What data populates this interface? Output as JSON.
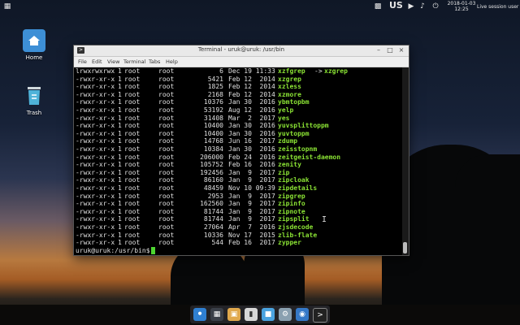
{
  "topbar": {
    "lang": "US",
    "clock_date": "2018-01-03",
    "clock_time": "12:25",
    "user": "Live session user"
  },
  "desktop": {
    "icons": [
      {
        "label": "Home",
        "icon": "home-folder-icon"
      },
      {
        "label": "Trash",
        "icon": "trash-icon"
      }
    ]
  },
  "terminal": {
    "title": "Terminal - uruk@uruk: /usr/bin",
    "menu": [
      "File",
      "Edit",
      "View",
      "Terminal",
      "Tabs",
      "Help"
    ],
    "rows": [
      {
        "perm": "lrwxrwxrwx",
        "links": "1",
        "owner": "root",
        "group": "root",
        "size": "6",
        "date": "Dec 19 11:33",
        "name": "xzfgrep",
        "target": "xzgrep"
      },
      {
        "perm": "-rwxr-xr-x",
        "links": "1",
        "owner": "root",
        "group": "root",
        "size": "5421",
        "date": "Feb 12  2014",
        "name": "xzgrep",
        "target": ""
      },
      {
        "perm": "-rwxr-xr-x",
        "links": "1",
        "owner": "root",
        "group": "root",
        "size": "1825",
        "date": "Feb 12  2014",
        "name": "xzless",
        "target": ""
      },
      {
        "perm": "-rwxr-xr-x",
        "links": "1",
        "owner": "root",
        "group": "root",
        "size": "2168",
        "date": "Feb 12  2014",
        "name": "xzmore",
        "target": ""
      },
      {
        "perm": "-rwxr-xr-x",
        "links": "1",
        "owner": "root",
        "group": "root",
        "size": "10376",
        "date": "Jan 30  2016",
        "name": "ybmtopbm",
        "target": ""
      },
      {
        "perm": "-rwxr-xr-x",
        "links": "1",
        "owner": "root",
        "group": "root",
        "size": "53192",
        "date": "Aug 12  2016",
        "name": "yelp",
        "target": ""
      },
      {
        "perm": "-rwxr-xr-x",
        "links": "1",
        "owner": "root",
        "group": "root",
        "size": "31408",
        "date": "Mar  2  2017",
        "name": "yes",
        "target": ""
      },
      {
        "perm": "-rwxr-xr-x",
        "links": "1",
        "owner": "root",
        "group": "root",
        "size": "10400",
        "date": "Jan 30  2016",
        "name": "yuvsplittoppm",
        "target": ""
      },
      {
        "perm": "-rwxr-xr-x",
        "links": "1",
        "owner": "root",
        "group": "root",
        "size": "10400",
        "date": "Jan 30  2016",
        "name": "yuvtoppm",
        "target": ""
      },
      {
        "perm": "-rwxr-xr-x",
        "links": "1",
        "owner": "root",
        "group": "root",
        "size": "14768",
        "date": "Jun 16  2017",
        "name": "zdump",
        "target": ""
      },
      {
        "perm": "-rwxr-xr-x",
        "links": "1",
        "owner": "root",
        "group": "root",
        "size": "10384",
        "date": "Jan 30  2016",
        "name": "zeisstopnm",
        "target": ""
      },
      {
        "perm": "-rwxr-xr-x",
        "links": "1",
        "owner": "root",
        "group": "root",
        "size": "206000",
        "date": "Feb 24  2016",
        "name": "zeitgeist-daemon",
        "target": ""
      },
      {
        "perm": "-rwxr-xr-x",
        "links": "1",
        "owner": "root",
        "group": "root",
        "size": "105752",
        "date": "Feb 16  2016",
        "name": "zenity",
        "target": ""
      },
      {
        "perm": "-rwxr-xr-x",
        "links": "1",
        "owner": "root",
        "group": "root",
        "size": "192456",
        "date": "Jan  9  2017",
        "name": "zip",
        "target": ""
      },
      {
        "perm": "-rwxr-xr-x",
        "links": "1",
        "owner": "root",
        "group": "root",
        "size": "86160",
        "date": "Jan  9  2017",
        "name": "zipcloak",
        "target": ""
      },
      {
        "perm": "-rwxr-xr-x",
        "links": "1",
        "owner": "root",
        "group": "root",
        "size": "48459",
        "date": "Nov 10 09:39",
        "name": "zipdetails",
        "target": ""
      },
      {
        "perm": "-rwxr-xr-x",
        "links": "1",
        "owner": "root",
        "group": "root",
        "size": "2953",
        "date": "Jan  9  2017",
        "name": "zipgrep",
        "target": ""
      },
      {
        "perm": "-rwxr-xr-x",
        "links": "1",
        "owner": "root",
        "group": "root",
        "size": "162560",
        "date": "Jan  9  2017",
        "name": "zipinfo",
        "target": ""
      },
      {
        "perm": "-rwxr-xr-x",
        "links": "1",
        "owner": "root",
        "group": "root",
        "size": "81744",
        "date": "Jan  9  2017",
        "name": "zipnote",
        "target": ""
      },
      {
        "perm": "-rwxr-xr-x",
        "links": "1",
        "owner": "root",
        "group": "root",
        "size": "81744",
        "date": "Jan  9  2017",
        "name": "zipsplit",
        "target": ""
      },
      {
        "perm": "-rwxr-xr-x",
        "links": "1",
        "owner": "root",
        "group": "root",
        "size": "27064",
        "date": "Apr  7  2016",
        "name": "zjsdecode",
        "target": ""
      },
      {
        "perm": "-rwxr-xr-x",
        "links": "1",
        "owner": "root",
        "group": "root",
        "size": "10336",
        "date": "Nov 17  2015",
        "name": "zlib-flate",
        "target": ""
      },
      {
        "perm": "-rwxr-xr-x",
        "links": "1",
        "owner": "root",
        "group": "root",
        "size": "544",
        "date": "Feb 16  2017",
        "name": "zypper",
        "target": ""
      }
    ],
    "prompt": "uruk@uruk:/usr/bin$",
    "symlink_arrow": "->"
  },
  "colors": {
    "executable_name": "#8ae234",
    "cursor": "#4ed630"
  },
  "dock": {
    "items": [
      "app-finder-icon",
      "files-icon",
      "store-icon",
      "document-icon",
      "desktop-icon",
      "settings-icon",
      "web-browser-icon",
      "terminal-icon"
    ]
  }
}
